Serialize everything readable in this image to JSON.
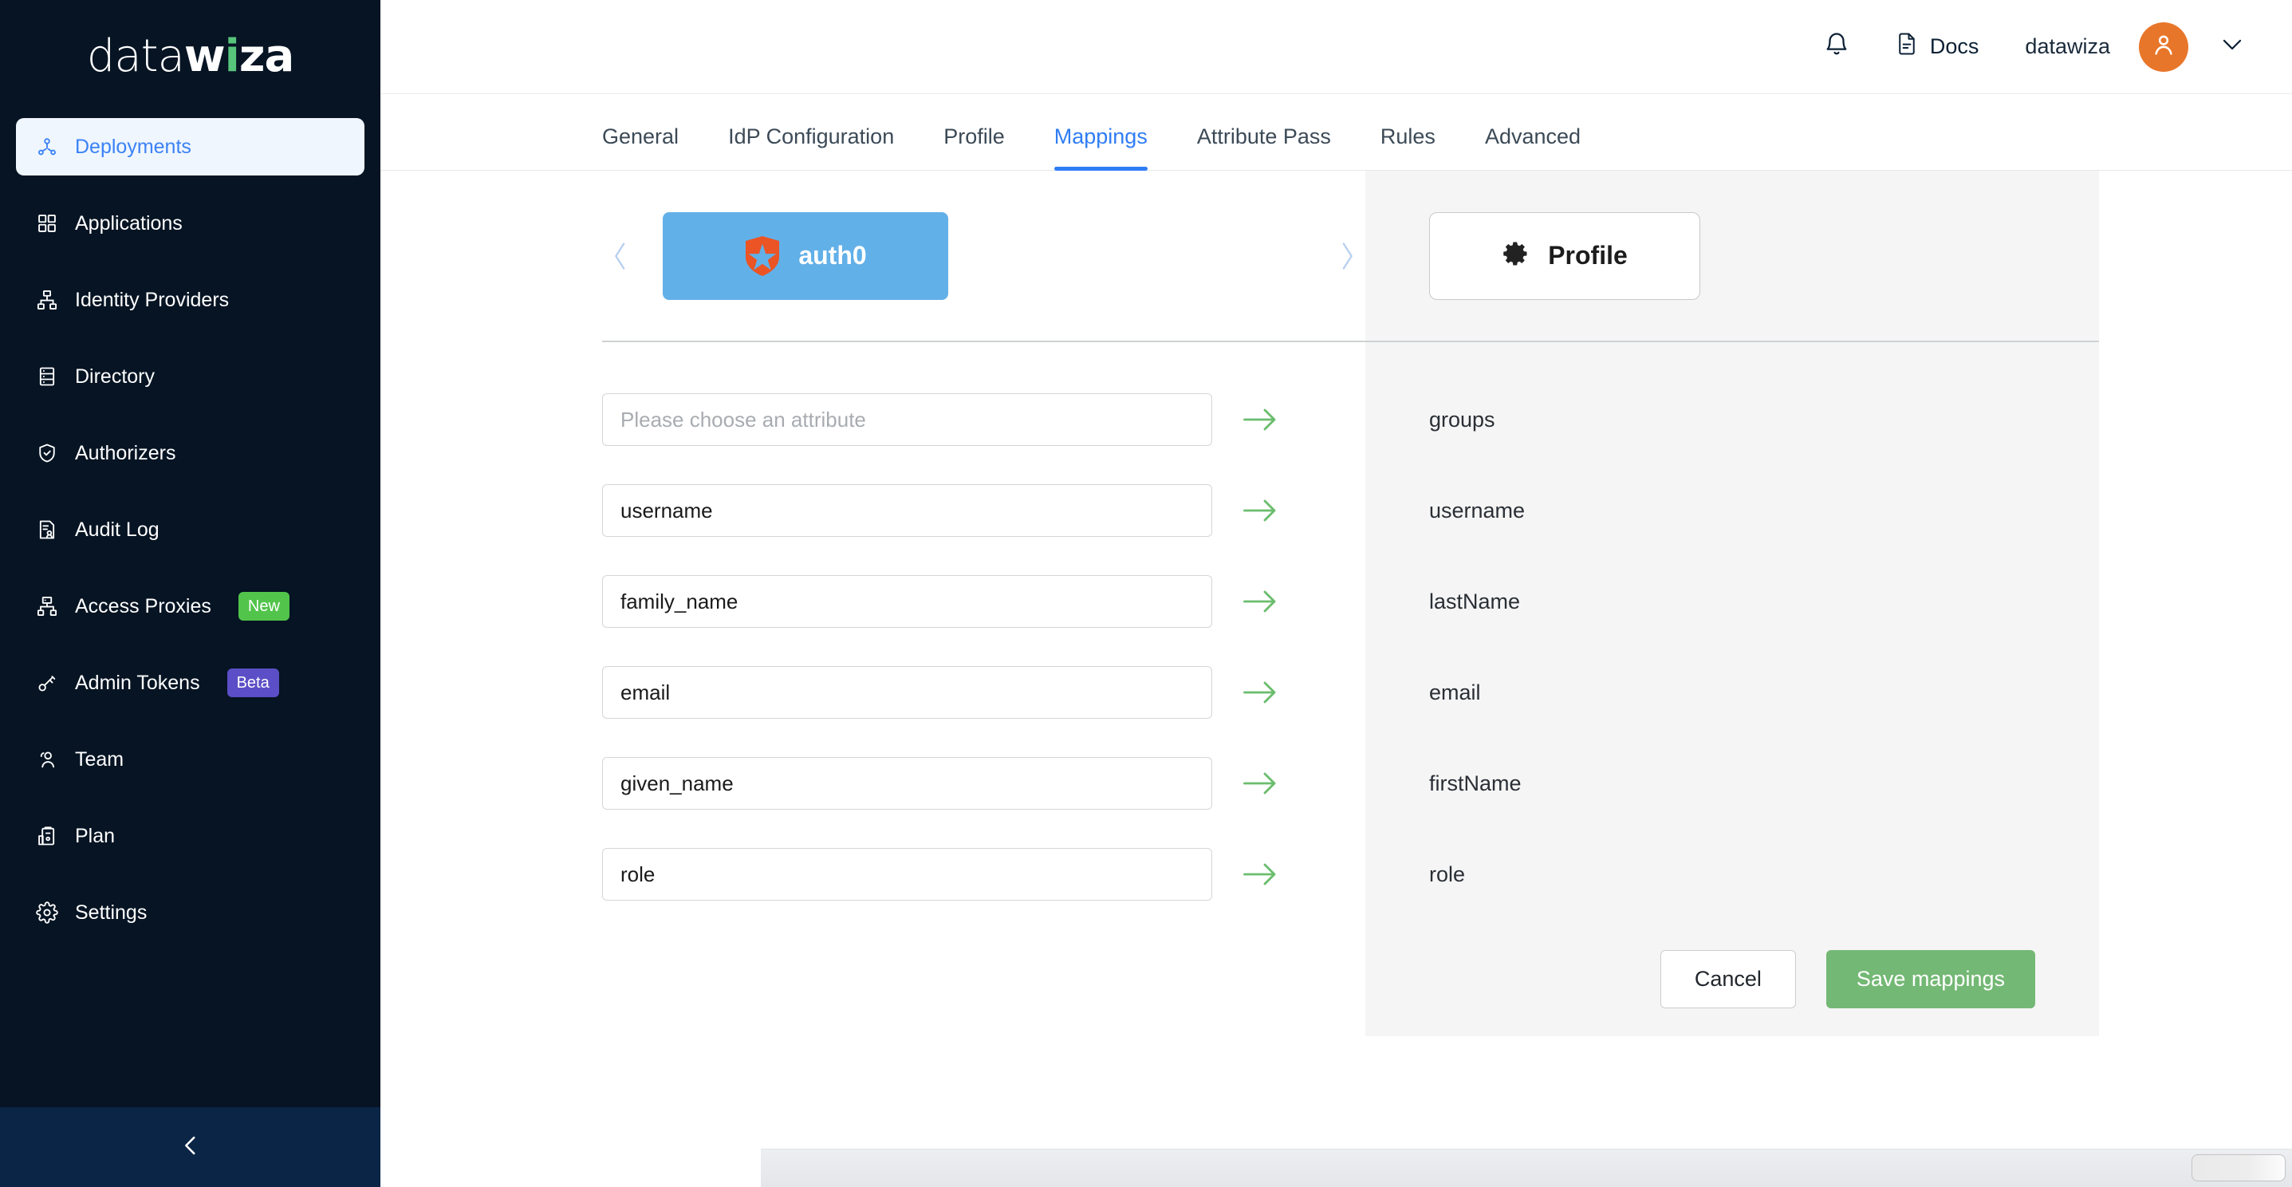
{
  "brand": {
    "logo_part1": "data",
    "logo_part2": "w",
    "logo_accent": "i",
    "logo_part3": "za"
  },
  "sidebar": {
    "items": [
      {
        "label": "Deployments",
        "icon": "deployments-icon",
        "active": true,
        "badge": null
      },
      {
        "label": "Applications",
        "icon": "applications-grid-icon",
        "active": false,
        "badge": null
      },
      {
        "label": "Identity Providers",
        "icon": "identity-providers-icon",
        "active": false,
        "badge": null
      },
      {
        "label": "Directory",
        "icon": "directory-server-icon",
        "active": false,
        "badge": null
      },
      {
        "label": "Authorizers",
        "icon": "shield-check-icon",
        "active": false,
        "badge": null
      },
      {
        "label": "Audit Log",
        "icon": "audit-log-icon",
        "active": false,
        "badge": null
      },
      {
        "label": "Access Proxies",
        "icon": "access-proxies-icon",
        "active": false,
        "badge": "New",
        "badge_type": "new"
      },
      {
        "label": "Admin Tokens",
        "icon": "token-key-icon",
        "active": false,
        "badge": "Beta",
        "badge_type": "beta"
      },
      {
        "label": "Team",
        "icon": "team-users-icon",
        "active": false,
        "badge": null
      },
      {
        "label": "Plan",
        "icon": "plan-clipboard-icon",
        "active": false,
        "badge": null
      },
      {
        "label": "Settings",
        "icon": "gear-icon",
        "active": false,
        "badge": null
      }
    ],
    "collapse_icon": "chevron-left-icon"
  },
  "topbar": {
    "notifications_icon": "bell-icon",
    "docs_icon": "document-icon",
    "docs_label": "Docs",
    "user_name": "datawiza",
    "avatar_icon": "user-avatar-icon",
    "caret_icon": "chevron-down-icon"
  },
  "tabs": [
    {
      "label": "General",
      "active": false
    },
    {
      "label": "IdP Configuration",
      "active": false
    },
    {
      "label": "Profile",
      "active": false
    },
    {
      "label": "Mappings",
      "active": true
    },
    {
      "label": "Attribute Pass",
      "active": false
    },
    {
      "label": "Rules",
      "active": false
    },
    {
      "label": "Advanced",
      "active": false
    }
  ],
  "idp_carousel": {
    "prev_icon": "chevron-left-icon",
    "next_icon": "chevron-right-icon",
    "selected": {
      "name": "auth0",
      "logo_icon": "auth0-shield-icon"
    }
  },
  "target_selector": {
    "name": "Profile",
    "icon": "gear-icon"
  },
  "mappings": [
    {
      "source_value": "",
      "source_placeholder": "Please choose an attribute",
      "arrow_icon": "arrow-right-icon",
      "target": "groups"
    },
    {
      "source_value": "username",
      "source_placeholder": "Please choose an attribute",
      "arrow_icon": "arrow-right-icon",
      "target": "username"
    },
    {
      "source_value": "family_name",
      "source_placeholder": "Please choose an attribute",
      "arrow_icon": "arrow-right-icon",
      "target": "lastName"
    },
    {
      "source_value": "email",
      "source_placeholder": "Please choose an attribute",
      "arrow_icon": "arrow-right-icon",
      "target": "email"
    },
    {
      "source_value": "given_name",
      "source_placeholder": "Please choose an attribute",
      "arrow_icon": "arrow-right-icon",
      "target": "firstName"
    },
    {
      "source_value": "role",
      "source_placeholder": "Please choose an attribute",
      "arrow_icon": "arrow-right-icon",
      "target": "role"
    }
  ],
  "actions": {
    "cancel_label": "Cancel",
    "save_label": "Save mappings"
  },
  "colors": {
    "sidebar_bg": "#061423",
    "sidebar_footer_bg": "#0b2546",
    "accent_blue": "#2f7df4",
    "active_nav_bg": "#eff6fe",
    "badge_new": "#52c44b",
    "badge_beta": "#5b4ec6",
    "auth0_card": "#62b0e8",
    "auth0_orange": "#eb5424",
    "save_green": "#73b874",
    "arrow_green": "#6bbd6e",
    "avatar_orange": "#e8762a",
    "panel_gray": "#f5f5f5"
  }
}
